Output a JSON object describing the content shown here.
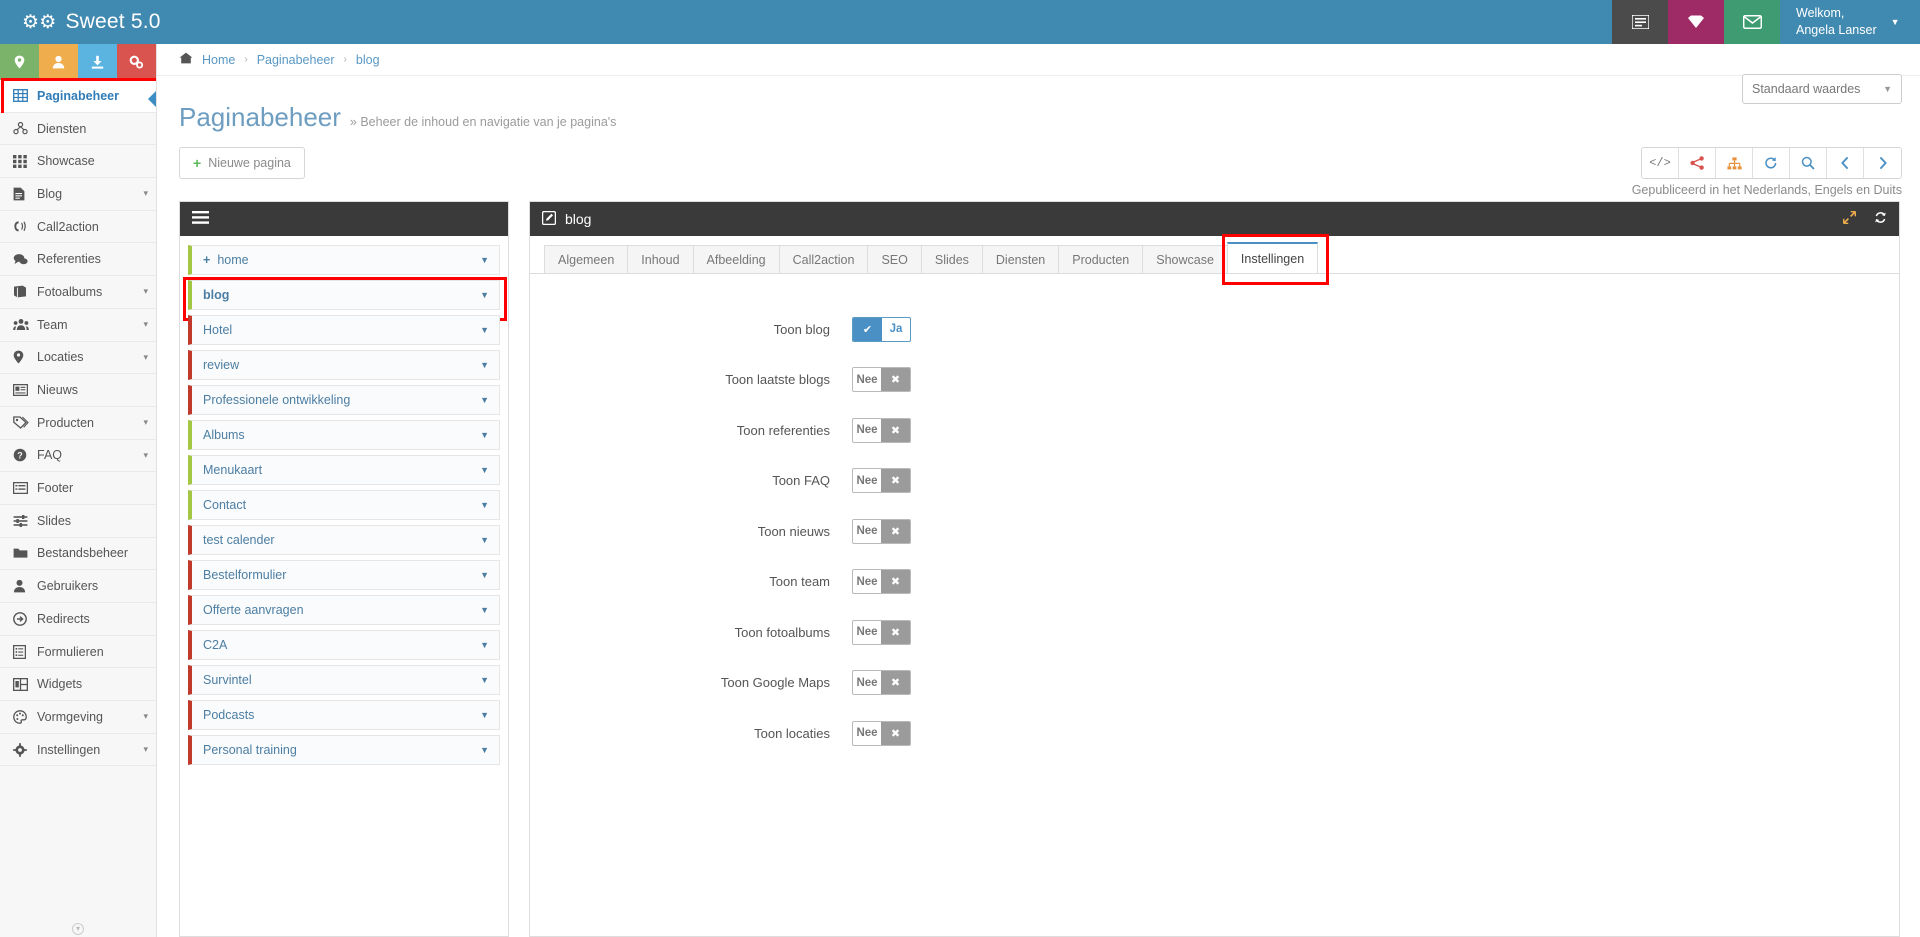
{
  "app": {
    "brand": "Sweet 5.0",
    "brand_icon": "gears-icon"
  },
  "topbar": {
    "icons": [
      {
        "name": "list-icon",
        "glyph": "☰"
      },
      {
        "name": "diamond-icon",
        "glyph": "◆"
      },
      {
        "name": "envelope-icon",
        "glyph": "✉"
      }
    ],
    "user": {
      "greeting": "Welkom,",
      "name": "Angela Lanser",
      "caret": "▼"
    }
  },
  "quick_icons": [
    {
      "name": "location-pin-icon",
      "glyph": "☰",
      "color": "#7cb36a"
    },
    {
      "name": "user-icon",
      "glyph": "☰",
      "color": "#f0ad4e"
    },
    {
      "name": "download-icon",
      "glyph": "☰",
      "color": "#5bb3e0"
    },
    {
      "name": "gears-icon",
      "glyph": "☰",
      "color": "#d9534f"
    }
  ],
  "sidebar": {
    "items": [
      {
        "label": "Paginabeheer",
        "icon": "table-icon",
        "active": true,
        "chevron": false
      },
      {
        "label": "Diensten",
        "icon": "services-icon",
        "active": false,
        "chevron": false
      },
      {
        "label": "Showcase",
        "icon": "grid-icon",
        "active": false,
        "chevron": false
      },
      {
        "label": "Blog",
        "icon": "document-icon",
        "active": false,
        "chevron": true
      },
      {
        "label": "Call2action",
        "icon": "megaphone-icon",
        "active": false,
        "chevron": false
      },
      {
        "label": "Referenties",
        "icon": "comments-icon",
        "active": false,
        "chevron": false
      },
      {
        "label": "Fotoalbums",
        "icon": "book-icon",
        "active": false,
        "chevron": true
      },
      {
        "label": "Team",
        "icon": "users-icon",
        "active": false,
        "chevron": true
      },
      {
        "label": "Locaties",
        "icon": "map-pin-icon",
        "active": false,
        "chevron": true
      },
      {
        "label": "Nieuws",
        "icon": "newspaper-icon",
        "active": false,
        "chevron": false
      },
      {
        "label": "Producten",
        "icon": "tag-icon",
        "active": false,
        "chevron": true
      },
      {
        "label": "FAQ",
        "icon": "question-icon",
        "active": false,
        "chevron": true
      },
      {
        "label": "Footer",
        "icon": "list-alt-icon",
        "active": false,
        "chevron": false
      },
      {
        "label": "Slides",
        "icon": "sliders-icon",
        "active": false,
        "chevron": false
      },
      {
        "label": "Bestandsbeheer",
        "icon": "folder-icon",
        "active": false,
        "chevron": false
      },
      {
        "label": "Gebruikers",
        "icon": "user-icon",
        "active": false,
        "chevron": false
      },
      {
        "label": "Redirects",
        "icon": "arrow-circle-icon",
        "active": false,
        "chevron": false
      },
      {
        "label": "Formulieren",
        "icon": "form-icon",
        "active": false,
        "chevron": false
      },
      {
        "label": "Widgets",
        "icon": "widgets-icon",
        "active": false,
        "chevron": false
      },
      {
        "label": "Vormgeving",
        "icon": "palette-icon",
        "active": false,
        "chevron": true
      },
      {
        "label": "Instellingen",
        "icon": "gear-icon",
        "active": false,
        "chevron": true
      }
    ]
  },
  "breadcrumb": {
    "home_icon": "home-icon",
    "items": [
      "Home",
      "Paginabeheer",
      "blog"
    ],
    "separator": "›"
  },
  "page_header": {
    "title": "Paginabeheer",
    "subtitle": "» Beheer de inhoud en navigatie van je pagina's",
    "defaults_select": {
      "value": "Standaard waardes",
      "caret": "▼"
    }
  },
  "actions": {
    "new_page_label": "Nieuwe pagina",
    "new_page_icon": "plus-icon",
    "toolbar": [
      {
        "name": "code-icon",
        "glyph": "</>",
        "color": "#777777"
      },
      {
        "name": "share-icon",
        "glyph": "❖",
        "color": "#d9534f"
      },
      {
        "name": "sitemap-icon",
        "glyph": "☴",
        "color": "#e8913a"
      },
      {
        "name": "history-icon",
        "glyph": "↺",
        "color": "#4a90c4"
      },
      {
        "name": "search-icon",
        "glyph": "⚲",
        "color": "#4a90c4"
      },
      {
        "name": "previous-icon",
        "glyph": "‹",
        "color": "#4a90c4"
      },
      {
        "name": "next-icon",
        "glyph": "›",
        "color": "#4a90c4"
      }
    ],
    "publish_note": "Gepubliceerd in het Nederlands, Engels en Duits"
  },
  "tree_panel": {
    "menu_icon": "hamburger-icon",
    "items": [
      {
        "label": "home",
        "border": "green",
        "plus": true,
        "selected": false
      },
      {
        "label": "blog",
        "border": "green",
        "plus": false,
        "selected": true
      },
      {
        "label": "Hotel",
        "border": "red",
        "plus": false,
        "selected": false
      },
      {
        "label": "review",
        "border": "red",
        "plus": false,
        "selected": false
      },
      {
        "label": "Professionele ontwikkeling",
        "border": "red",
        "plus": false,
        "selected": false
      },
      {
        "label": "Albums",
        "border": "green",
        "plus": false,
        "selected": false
      },
      {
        "label": "Menukaart",
        "border": "green",
        "plus": false,
        "selected": false
      },
      {
        "label": "Contact",
        "border": "green",
        "plus": false,
        "selected": false
      },
      {
        "label": "test calender",
        "border": "red",
        "plus": false,
        "selected": false
      },
      {
        "label": "Bestelformulier",
        "border": "red",
        "plus": false,
        "selected": false
      },
      {
        "label": "Offerte aanvragen",
        "border": "red",
        "plus": false,
        "selected": false
      },
      {
        "label": "C2A",
        "border": "red",
        "plus": false,
        "selected": false
      },
      {
        "label": "Survintel",
        "border": "red",
        "plus": false,
        "selected": false
      },
      {
        "label": "Podcasts",
        "border": "red",
        "plus": false,
        "selected": false
      },
      {
        "label": "Personal training",
        "border": "red",
        "plus": false,
        "selected": false
      }
    ],
    "caret": "▼"
  },
  "edit_panel": {
    "title": "blog",
    "title_icon": "edit-icon",
    "header_icons": [
      {
        "name": "expand-icon",
        "glyph": "⤢"
      },
      {
        "name": "refresh-icon",
        "glyph": "↻"
      }
    ],
    "tabs": [
      {
        "label": "Algemeen",
        "active": false
      },
      {
        "label": "Inhoud",
        "active": false
      },
      {
        "label": "Afbeelding",
        "active": false
      },
      {
        "label": "Call2action",
        "active": false
      },
      {
        "label": "SEO",
        "active": false
      },
      {
        "label": "Slides",
        "active": false
      },
      {
        "label": "Diensten",
        "active": false
      },
      {
        "label": "Producten",
        "active": false
      },
      {
        "label": "Showcase",
        "active": false
      },
      {
        "label": "Instellingen",
        "active": true
      }
    ],
    "settings": {
      "on_label": "Ja",
      "off_label": "Nee",
      "on_icon": "check-icon",
      "off_icon": "cross-icon",
      "rows": [
        {
          "label": "Toon blog",
          "value": true
        },
        {
          "label": "Toon laatste blogs",
          "value": false
        },
        {
          "label": "Toon referenties",
          "value": false
        },
        {
          "label": "Toon FAQ",
          "value": false
        },
        {
          "label": "Toon nieuws",
          "value": false
        },
        {
          "label": "Toon team",
          "value": false
        },
        {
          "label": "Toon fotoalbums",
          "value": false
        },
        {
          "label": "Toon Google Maps",
          "value": false
        },
        {
          "label": "Toon locaties",
          "value": false
        }
      ]
    }
  },
  "colors": {
    "brand_blue": "#4089b0",
    "accent_blue": "#4a90c4",
    "panel_dark": "#3a3a3a",
    "green": "#a3c644",
    "red": "#c0392b",
    "highlight": "#ff0000"
  }
}
